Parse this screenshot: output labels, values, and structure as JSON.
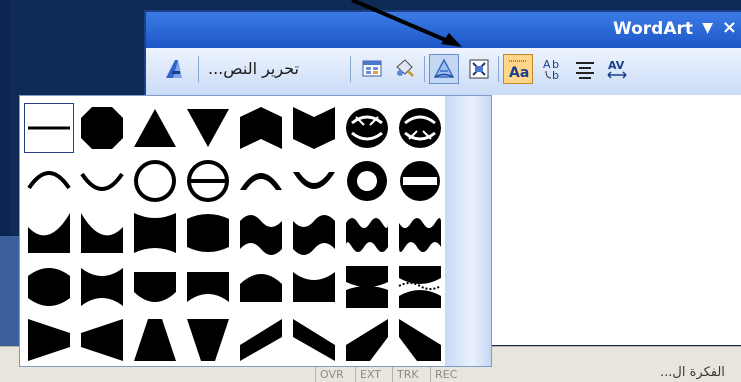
{
  "toolbar": {
    "title": "WordArt",
    "dropdown_icon": "down-triangle-icon",
    "close_label": "×",
    "edit_text_label": "تحرير النص...",
    "buttons": [
      {
        "name": "wordart-insert-button",
        "icon": "wordart-a-icon"
      },
      {
        "name": "edit-text-button",
        "icon": "text"
      },
      {
        "name": "wordart-gallery-button",
        "icon": "gallery-icon"
      },
      {
        "name": "format-wordart-button",
        "icon": "paint-bucket-icon"
      },
      {
        "name": "wordart-shape-button",
        "icon": "shape-a-icon"
      },
      {
        "name": "text-wrapping-button",
        "icon": "wrap-icon"
      },
      {
        "name": "same-letter-heights-button",
        "icon": "aa-icon"
      },
      {
        "name": "vertical-text-button",
        "icon": "ab-vertical-icon"
      },
      {
        "name": "alignment-button",
        "icon": "align-icon"
      },
      {
        "name": "character-spacing-button",
        "icon": "av-spacing-icon"
      }
    ]
  },
  "gallery": {
    "selected_index": 0,
    "shapes": [
      "plain-text",
      "stop",
      "triangle-up",
      "triangle-down",
      "chevron-up",
      "chevron-down",
      "ring-inside",
      "ring-outside",
      "arch-up-curve",
      "arch-down-curve",
      "circle-curve",
      "button-curve",
      "arch-up-pour",
      "arch-down-pour",
      "circle-pour",
      "button-pour",
      "curve-up",
      "curve-down",
      "can-up",
      "can-down",
      "wave-1",
      "wave-2",
      "double-wave-1",
      "double-wave-2",
      "inflate",
      "deflate",
      "inflate-bottom",
      "deflate-bottom",
      "inflate-top",
      "deflate-top",
      "deflate-inflate",
      "deflate-inflate-deflate",
      "fade-right",
      "fade-left",
      "fade-up",
      "fade-down",
      "slant-up",
      "slant-down",
      "cascade-up",
      "cascade-down"
    ]
  },
  "statusbar": {
    "cells": [
      "OVR",
      "EXT",
      "TRK",
      "REC"
    ],
    "arabic_left": "الفكرة ال...",
    "arabic_right": "..."
  },
  "colors": {
    "title_gradient_top": "#3c7ce6",
    "title_gradient_bottom": "#1c56c7",
    "highlight": "#ffd68a",
    "backdrop": "#0e2b55"
  }
}
